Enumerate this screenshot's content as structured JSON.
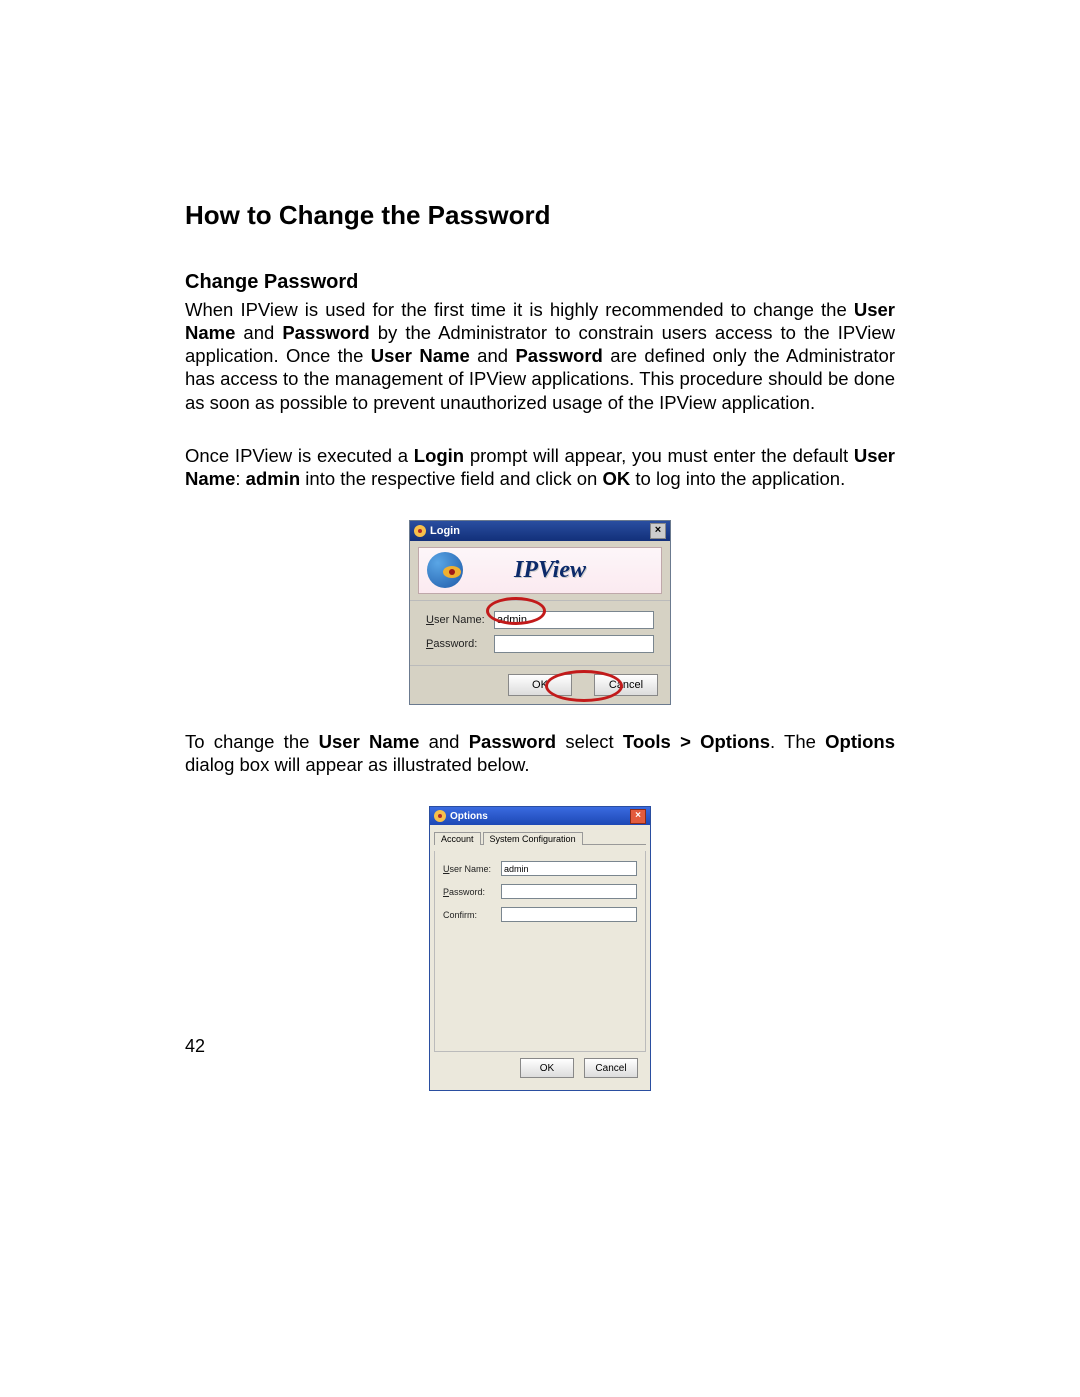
{
  "title": "How to Change the Password",
  "subtitle": "Change Password",
  "para1": {
    "pre1": "When IPView is used for the first time it is highly recommended to change the ",
    "b1": "User Name",
    "mid1": " and ",
    "b2": "Password",
    "mid2": " by the Administrator to constrain users access to the IPView application. Once the ",
    "b3": "User Name",
    "mid3": " and ",
    "b4": "Password",
    "post": " are defined only the Administrator has access to the management of IPView applications. This procedure should be done as soon as possible to prevent unauthorized usage of the IPView application."
  },
  "para2": {
    "pre": "Once IPView is executed a ",
    "b1": "Login",
    "mid1": " prompt will appear, you must enter the default ",
    "b2": "User Name",
    "sep": ": ",
    "b3": "admin",
    "mid2": " into the respective field and click on ",
    "b4": "OK",
    "post": " to log into the application."
  },
  "para3": {
    "pre": "To change the ",
    "b1": "User Name",
    "mid1": " and ",
    "b2": "Password",
    "mid2": " select ",
    "b3": "Tools > Options",
    "mid3": ". The ",
    "b4": "Options",
    "post": " dialog box will appear as illustrated below."
  },
  "login": {
    "title": "Login",
    "banner": "IPView",
    "user_label": "User Name:",
    "user_value": "admin",
    "pass_label": "Password:",
    "pass_value": "",
    "ok": "OK",
    "cancel": "Cancel"
  },
  "options": {
    "title": "Options",
    "tab_account": "Account",
    "tab_sys": "System Configuration",
    "user_label": "User Name:",
    "user_value": "admin",
    "pass_label": "Password:",
    "pass_value": "",
    "confirm_label": "Confirm:",
    "confirm_value": "",
    "ok": "OK",
    "cancel": "Cancel"
  },
  "page_number": "42"
}
